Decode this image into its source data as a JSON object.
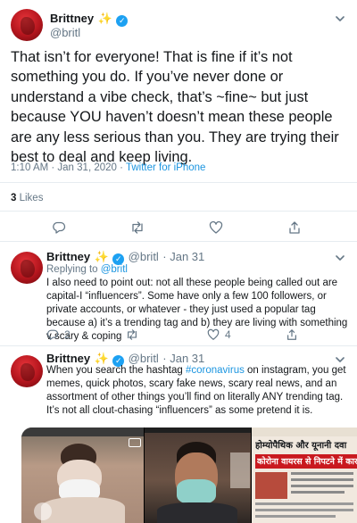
{
  "main_tweet": {
    "name": "Brittney",
    "sparkle": "✨",
    "handle": "@britl",
    "text": "That isn’t for everyone! That is fine if it’s not something you do. If you’ve never done or understand a vibe check, that’s ~fine~ but just because YOU haven’t doesn’t mean these people are any less serious than you. They are trying their best to deal and keep living.",
    "timestamp": "1:10 AM · Jan 31, 2020 · ",
    "source": "Twitter for iPhone",
    "likes_count": "3",
    "likes_label": "Likes"
  },
  "reply1": {
    "name": "Brittney",
    "sparkle": "✨",
    "handle": "@britl",
    "date": "· Jan 31",
    "replying_to_label": "Replying to ",
    "replying_to_handle": "@britl",
    "text": "I also need to point out: not all these people being called out are capital-I “influencers”. Some have only a few 100 followers, or private accounts, or whatever - they just used a popular tag because a) it’s a trending tag and b) they are living with something v scary & coping",
    "reply_count": "2",
    "like_count": "4"
  },
  "reply2": {
    "name": "Brittney",
    "sparkle": "✨",
    "handle": "@britl",
    "date": "· Jan 31",
    "text_before": "When you search the hashtag ",
    "hashtag": "#coronavirus",
    "text_after": " on instagram, you get memes, quick photos, scary fake news, scary real news, and an assortment of other things you’ll find on literally ANY trending tag. It’s not all clout-chasing “influencers” as some pretend it is."
  },
  "media": {
    "panel1_caption": "",
    "panel3_headline_1": "होम्योपैथिक और यूनानी दवा",
    "panel3_headline_2": "कोरोना वायरस से निपटने में कारगर"
  },
  "colors": {
    "accent": "#1da1f2",
    "link": "#1b95e0",
    "secondary_text": "#657786",
    "divider": "#e6ecf0",
    "avatar": "#c0191f"
  }
}
